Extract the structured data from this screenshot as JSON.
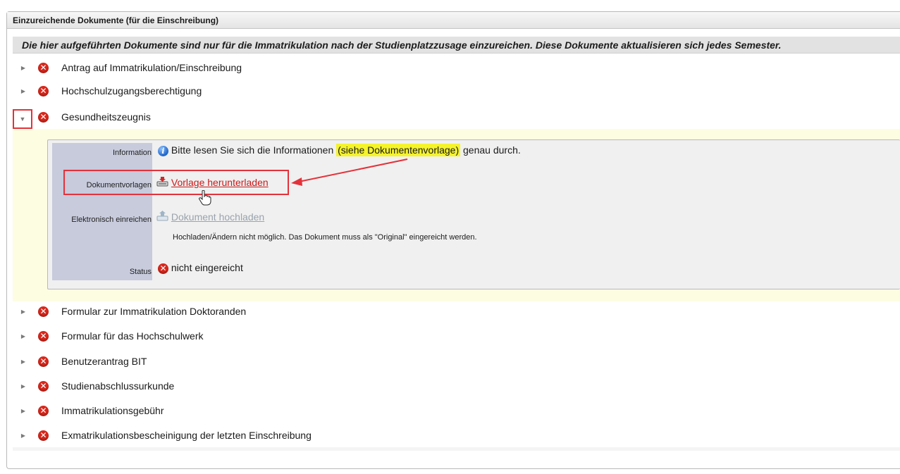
{
  "panel": {
    "title": "Einzureichende Dokumente (für die Einschreibung)"
  },
  "notice": "Die hier aufgeführten Dokumente sind nur für die Immatrikulation nach der Studienplatzzusage einzureichen. Diese Dokumente aktualisieren sich jedes Semester.",
  "documents_top": [
    {
      "label": "Antrag auf Immatrikulation/Einschreibung"
    },
    {
      "label": "Hochschulzugangsberechtigung"
    },
    {
      "label": "Gesundheitszeugnis"
    }
  ],
  "expanded": {
    "info_label": "Information",
    "info_text_before": "Bitte lesen Sie sich die Informationen ",
    "info_highlight": "(siehe Dokumentenvorlage)",
    "info_text_after": " genau durch.",
    "templates_label": "Dokumentvorlagen",
    "download_link": "Vorlage herunterladen",
    "submit_label": "Elektronisch einreichen",
    "upload_link": "Dokument hochladen",
    "upload_note": "Hochladen/Ändern nicht möglich. Das Dokument muss als \"Original\" eingereicht werden.",
    "status_label": "Status",
    "status_value": "nicht eingereicht"
  },
  "documents_bottom": [
    {
      "label": "Formular zur Immatrikulation Doktoranden"
    },
    {
      "label": "Formular für das Hochschulwerk"
    },
    {
      "label": "Benutzerantrag BIT"
    },
    {
      "label": "Studienabschlussurkunde"
    },
    {
      "label": "Immatrikulationsgebühr"
    },
    {
      "label": "Exmatrikulationsbescheinigung der letzten Einschreibung"
    }
  ],
  "icons": {
    "collapsed": "triangle-right-icon",
    "expanded": "triangle-down-icon",
    "error": "error-x-icon",
    "info": "info-icon",
    "download": "download-tray-icon",
    "upload": "upload-tray-icon",
    "cursor": "hand-pointer-icon"
  },
  "colors": {
    "error": "#d8271b",
    "highlight": "#f5f32b",
    "annotation": "#e3323a",
    "link": "#c91b1b",
    "expanded_bg": "#fdfde2"
  }
}
